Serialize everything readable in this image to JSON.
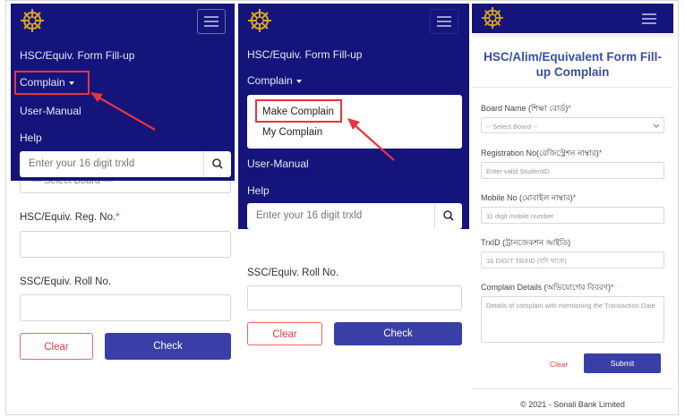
{
  "panel1": {
    "nav": {
      "title": "HSC/Equiv. Form Fill-up",
      "complain": "Complain",
      "manual": "User-Manual",
      "help": "Help"
    },
    "search": {
      "placeholder": "Enter your 16 digit trxld"
    },
    "select_board": "— Select Board —",
    "reg_label": "HSC/Equiv. Reg. No.",
    "required_mark": "*",
    "roll_label": "SSC/Equiv. Roll No.",
    "clear": "Clear",
    "check": "Check"
  },
  "panel2": {
    "nav": {
      "title": "HSC/Equiv. Form Fill-up",
      "complain": "Complain",
      "manual": "User-Manual",
      "help": "Help"
    },
    "dropdown": [
      "Make Complain",
      "My Complain"
    ],
    "search": {
      "placeholder": "Enter your 16 digit trxld"
    },
    "roll_label": "SSC/Equiv. Roll No.",
    "clear": "Clear",
    "check": "Check"
  },
  "panel3": {
    "title": "HSC/Alim/Equivalent Form Fill-up Complain",
    "board_label": "Board Name (শিক্ষা বোর্ড)",
    "board_select": "-- Select Board --",
    "reg_label": "Registration No(রেজিস্ট্রেশন নাম্বার)",
    "reg_ph": "Enter valid StudentID",
    "mobile_label": "Mobile No (মোবাইল নাম্বার)",
    "mobile_ph": "11 digit mobile number",
    "trx_label": "TrxID (ট্রানজেকশন আইডি)",
    "trx_ph": "16 DIGIT TRXID (যদি থাকে)",
    "details_label": "Complain Details (অভিযোগের বিবরণ)",
    "details_ph": "Details of complain with mentioning the Transaction Date",
    "required_mark": "*",
    "clear": "Clear",
    "submit": "Submit",
    "footer": "© 2021 - Sonali Bank Limited"
  },
  "colors": {
    "navy": "#14147a",
    "accent_red": "#e8343f",
    "button_blue": "#3a3fa8"
  }
}
